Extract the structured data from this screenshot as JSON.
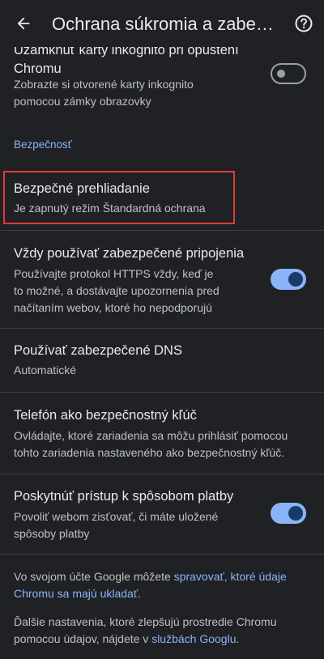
{
  "appbar": {
    "title": "Ochrana súkromia a zabezpečenie",
    "back_icon": "arrow-back-icon",
    "help_icon": "help-icon"
  },
  "incognito_lock": {
    "title_line1": "Uzamknúť karty inkognito pri opustení",
    "title_line2": "Chromu",
    "sub_line1": "Zobrazte si otvorené karty inkognito",
    "sub_line2": "pomocou zámky obrazovky",
    "enabled": false
  },
  "security_section": {
    "header": "Bezpečnosť"
  },
  "safe_browsing": {
    "title": "Bezpečné prehliadanie",
    "subtitle": "Je zapnutý režim Štandardná ochrana"
  },
  "https_always": {
    "title": "Vždy používať zabezpečené pripojenia",
    "sub_line1": "Používajte protokol HTTPS vždy, keď je",
    "sub_line2": "to možné, a dostávajte upozornenia pred",
    "sub_line3": "načítaním webov, ktoré ho nepodporujú",
    "enabled": true
  },
  "secure_dns": {
    "title": "Používať zabezpečené DNS",
    "subtitle": "Automatické"
  },
  "security_key": {
    "title": "Telefón ako bezpečnostný kľúč",
    "sub_line1": "Ovládajte, ktoré zariadenia sa môžu prihlásiť pomocou",
    "sub_line2": "tohto zariadenia nastaveného ako bezpečnostný kľúč."
  },
  "payment_methods": {
    "title": "Poskytnúť prístup k spôsobom platby",
    "sub_line1": "Povoliť webom zisťovať, či máte uložené",
    "sub_line2": "spôsoby platby",
    "enabled": true
  },
  "footer": {
    "p1_prefix": "Vo svojom účte Google môžete ",
    "p1_link_part1": "spravovať, ktoré údaje",
    "p1_link_part2": "Chromu sa majú ukladať",
    "p1_suffix": ".",
    "p2_line1": "Ďalšie nastavenia, ktoré zlepšujú prostredie Chromu",
    "p2_prefix": "pomocou údajov, nájdete v ",
    "p2_link": "službách Googlu",
    "p2_suffix": "."
  },
  "colors": {
    "background": "#202124",
    "accent": "#8ab4f8",
    "highlight": "#e53935"
  }
}
